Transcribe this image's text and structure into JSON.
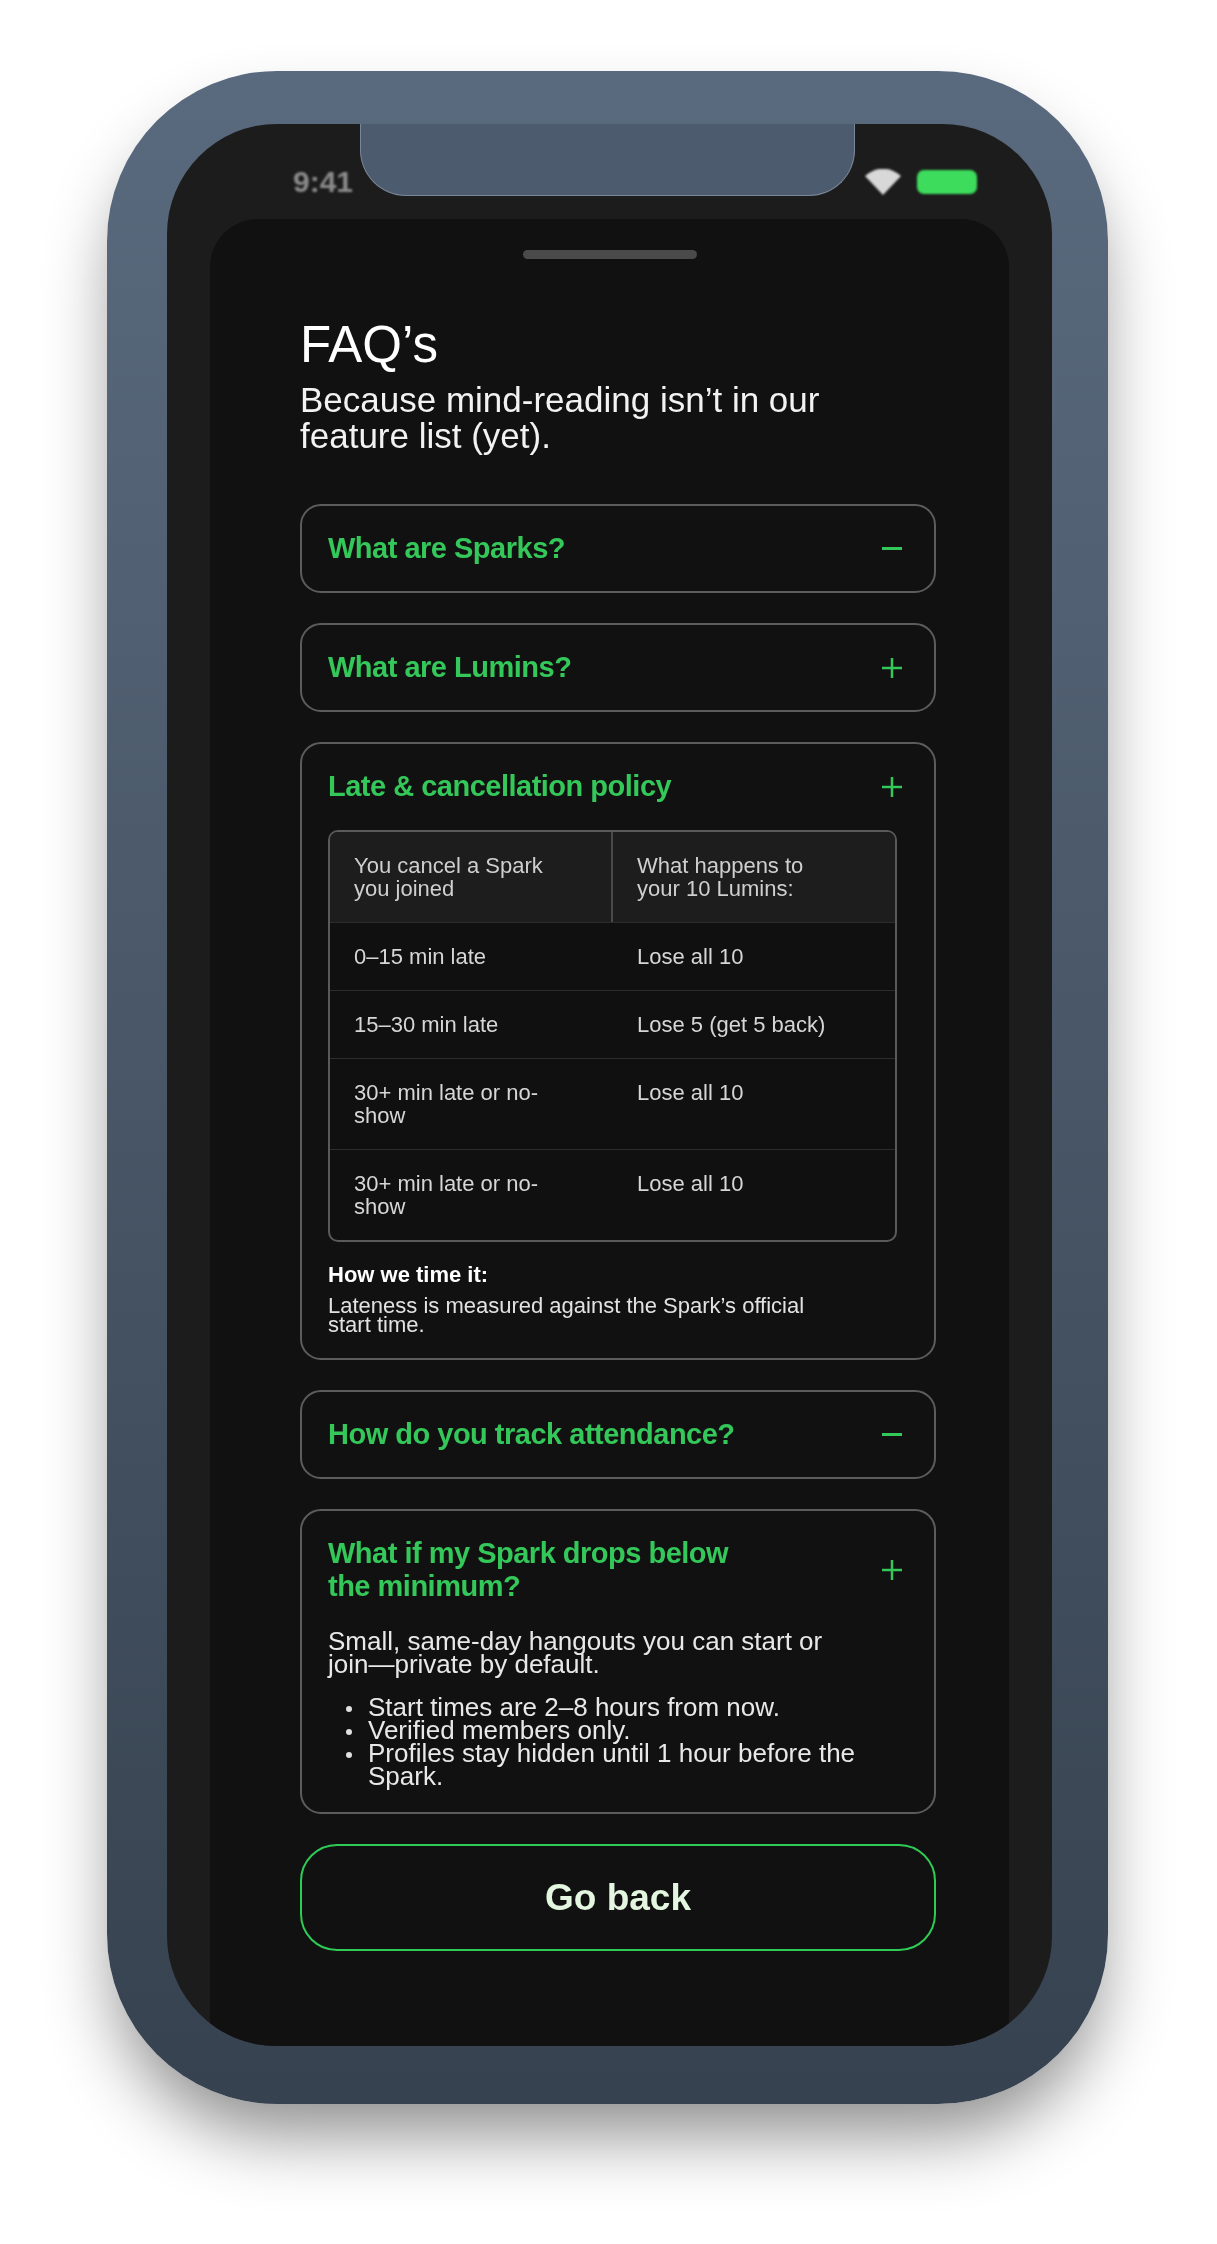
{
  "status_bar": {
    "time": "9:41"
  },
  "sheet": {
    "title": "FAQ’s",
    "subtitle": "Because mind-reading isn’t in our feature list (yet)."
  },
  "faq_items": [
    {
      "question": "What are Sparks?",
      "expanded": true
    },
    {
      "question": "What are Lumins?",
      "expanded": false
    },
    {
      "question": "Late & cancellation policy",
      "expanded": false,
      "answer": {
        "kind": "table",
        "columns": [
          "You cancel a Spark you joined",
          "What happens to your 10 Lumins:"
        ],
        "rows": [
          [
            "0–15 min late",
            "Lose all 10"
          ],
          [
            "15–30 min late",
            "Lose 5 (get 5 back)"
          ],
          [
            "30+ min late or no-show",
            "Lose all 10"
          ],
          [
            "30+ min late or no-show",
            "Lose all 10"
          ]
        ],
        "note_title": "How we time it:",
        "note": "Lateness is measured against the Spark’s official start time."
      }
    },
    {
      "question": "How do you track attendance?",
      "expanded": true
    },
    {
      "question": "What if my Spark drops below the minimum?",
      "expanded": false,
      "answer": {
        "kind": "list",
        "paragraph": "Small, same-day hangouts you can start or join—private by default.",
        "bullets": [
          "Start times are 2–8 hours from now.",
          "Verified members only.",
          "Profiles stay hidden until 1 hour before the Spark."
        ]
      }
    }
  ],
  "buttons": [
    {
      "label": "Go back"
    }
  ]
}
